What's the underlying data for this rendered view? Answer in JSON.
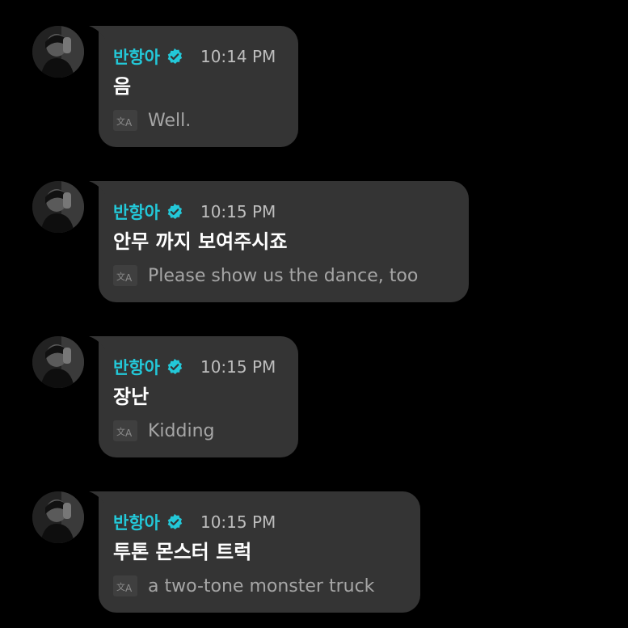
{
  "colors": {
    "background": "#000000",
    "bubble": "#343434",
    "username": "#23c8d8",
    "verified_badge": "#23c8d8",
    "message_text": "#ffffff",
    "timestamp": "#bdbdbd",
    "translation_text": "#a6a6a6"
  },
  "icons": {
    "verified": "verified-badge-icon",
    "translate": "translate-icon"
  },
  "messages": [
    {
      "username": "반항아",
      "time": "10:14 PM",
      "text": "음",
      "translation": "Well."
    },
    {
      "username": "반항아",
      "time": "10:15 PM",
      "text": "안무 까지 보여주시죠",
      "translation": "Please show us the dance, too"
    },
    {
      "username": "반항아",
      "time": "10:15 PM",
      "text": "장난",
      "translation": "Kidding"
    },
    {
      "username": "반항아",
      "time": "10:15 PM",
      "text": "투톤 몬스터 트럭",
      "translation": "a two-tone monster truck"
    }
  ]
}
